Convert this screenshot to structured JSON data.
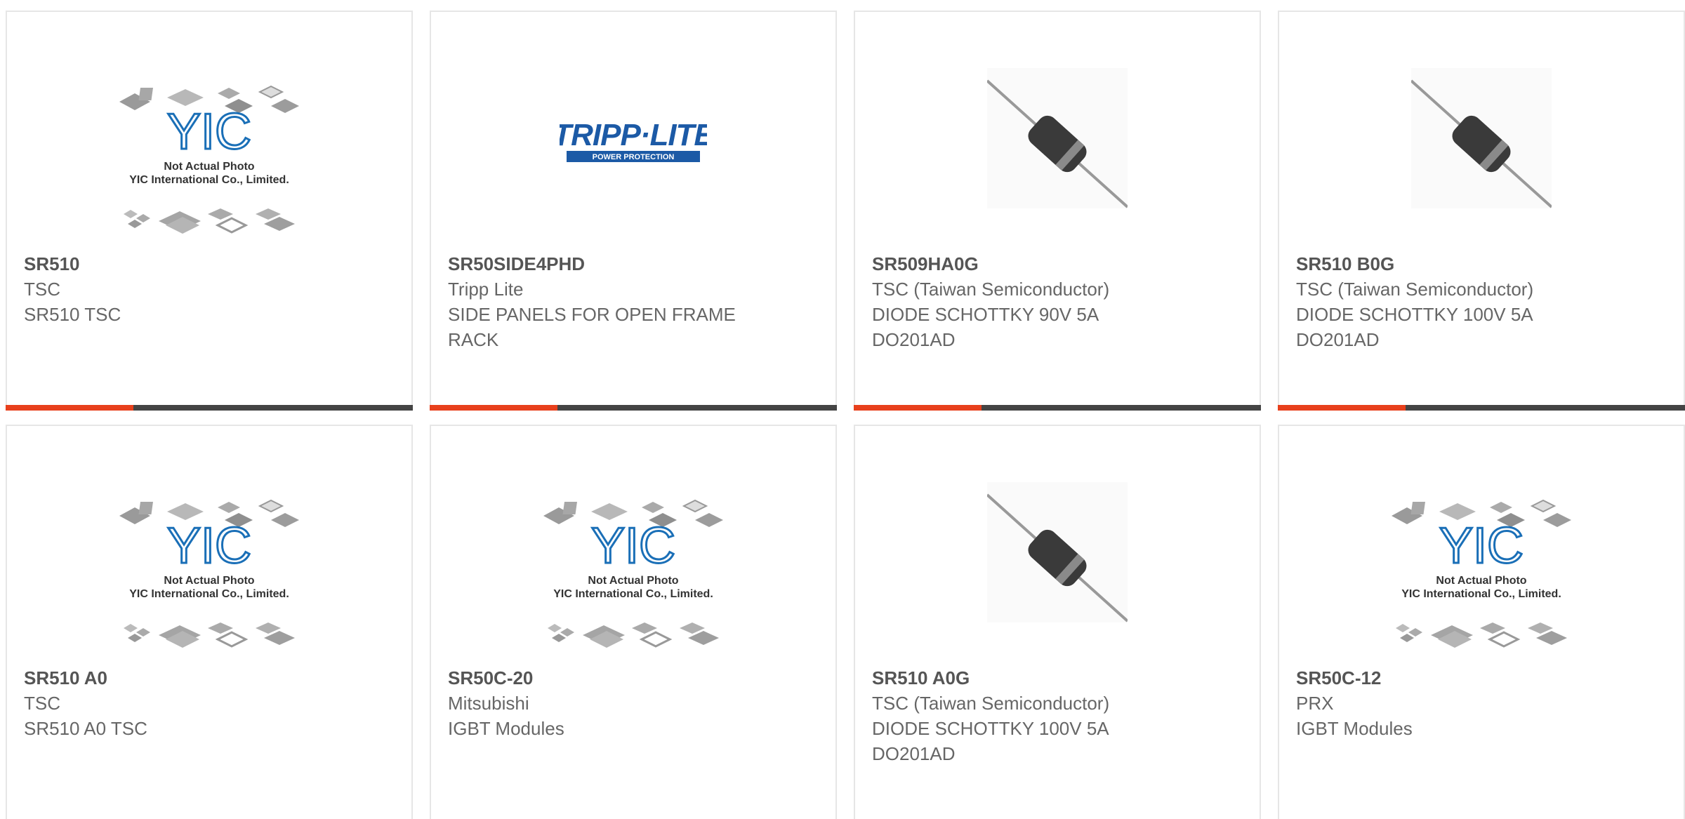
{
  "colors": {
    "accent": "#e8401c",
    "bar": "#444444",
    "text_bold": "#555555",
    "text": "#666666",
    "yic_blue": "#1a6fb7",
    "tripp_blue": "#1c5aa6"
  },
  "placeholder": {
    "line1": "Not Actual Photo",
    "line2": "YIC International Co., Limited.",
    "logo": "YIC"
  },
  "tripp_logo": {
    "main": "TRIPP·LITE",
    "sub": "POWER PROTECTION"
  },
  "products": [
    {
      "part": "SR510",
      "manufacturer": "TSC",
      "description": "SR510 TSC",
      "image": "yic-placeholder"
    },
    {
      "part": "SR50SIDE4PHD",
      "manufacturer": "Tripp Lite",
      "description": "SIDE PANELS FOR OPEN FRAME RACK",
      "image": "tripp-lite-logo"
    },
    {
      "part": "SR509HA0G",
      "manufacturer": "TSC (Taiwan Semiconductor)",
      "description": "DIODE SCHOTTKY 90V 5A DO201AD",
      "image": "diode-photo"
    },
    {
      "part": "SR510 B0G",
      "manufacturer": "TSC (Taiwan Semiconductor)",
      "description": "DIODE SCHOTTKY 100V 5A DO201AD",
      "image": "diode-photo"
    },
    {
      "part": "SR510 A0",
      "manufacturer": "TSC",
      "description": "SR510 A0 TSC",
      "image": "yic-placeholder"
    },
    {
      "part": "SR50C-20",
      "manufacturer": "Mitsubishi",
      "description": "IGBT Modules",
      "image": "yic-placeholder"
    },
    {
      "part": "SR510 A0G",
      "manufacturer": "TSC (Taiwan Semiconductor)",
      "description": "DIODE SCHOTTKY 100V 5A DO201AD",
      "image": "diode-photo"
    },
    {
      "part": "SR50C-12",
      "manufacturer": "PRX",
      "description": "IGBT Modules",
      "image": "yic-placeholder"
    }
  ]
}
